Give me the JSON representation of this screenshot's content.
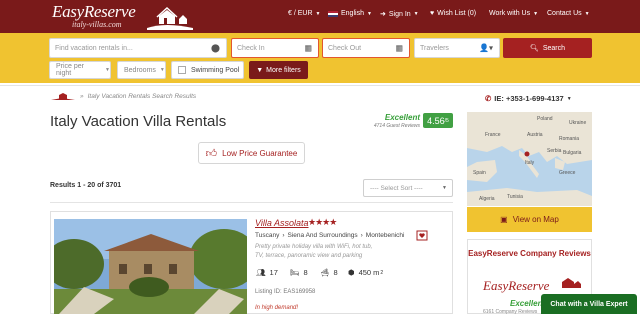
{
  "header": {
    "logo_main": "EasyReserve",
    "logo_sub": "italy-villas.com",
    "currency": "€ / EUR",
    "language": "English",
    "signin": "Sign In",
    "wishlist": "Wish List (0)",
    "work": "Work with Us",
    "contact": "Contact Us"
  },
  "search": {
    "destination_placeholder": "Find vacation rentals in...",
    "checkin_placeholder": "Check In",
    "checkout_placeholder": "Check Out",
    "travelers_placeholder": "Travelers",
    "search_label": "Search"
  },
  "filters": {
    "price": "Price per night",
    "bedrooms": "Bedrooms",
    "pool": "Swimming Pool",
    "more": "More filters"
  },
  "breadcrumb": "Italy Vacation Rentals Search Results",
  "phone": "IE: +353-1-699-4137",
  "page": {
    "title": "Italy Vacation Villa Rentals",
    "rating_word": "Excellent",
    "rating_count": "4714 Guest Reviews",
    "score": "4.56",
    "score_max": "/5",
    "low_price": "Low Price Guarantee",
    "results": "Results 1 - 20 of 3701",
    "sort_placeholder": "---- Select Sort ----"
  },
  "listing": {
    "name": "Villa Assolata",
    "stars": "★★★★",
    "region": "Tuscany",
    "area": "Siena And Surroundings",
    "town": "Montebenichi",
    "description": "Pretty private holiday villa with WiFi, hot tub, TV, terrace, panoramic view and parking",
    "guests": "17",
    "bedrooms": "8",
    "bathrooms": "8",
    "size": "450 m",
    "size_sup": "2",
    "listing_id": "Listing ID: EAS169958",
    "demand": "In high demand!"
  },
  "sidebar": {
    "view_map": "View on Map",
    "map_labels": [
      "France",
      "Italy",
      "Spain",
      "Romania",
      "Bulgaria",
      "Serbia",
      "Greece",
      "Austria",
      "Poland",
      "Ukraine",
      "Tunisia",
      "Algeria"
    ],
    "reviews_title": "EasyReserve Company Reviews",
    "reviews_logo": "EasyReserve",
    "reviews_excellent": "Excellent",
    "reviews_small": "6161 Company Reviews"
  },
  "chat": "Chat with a Villa Expert"
}
